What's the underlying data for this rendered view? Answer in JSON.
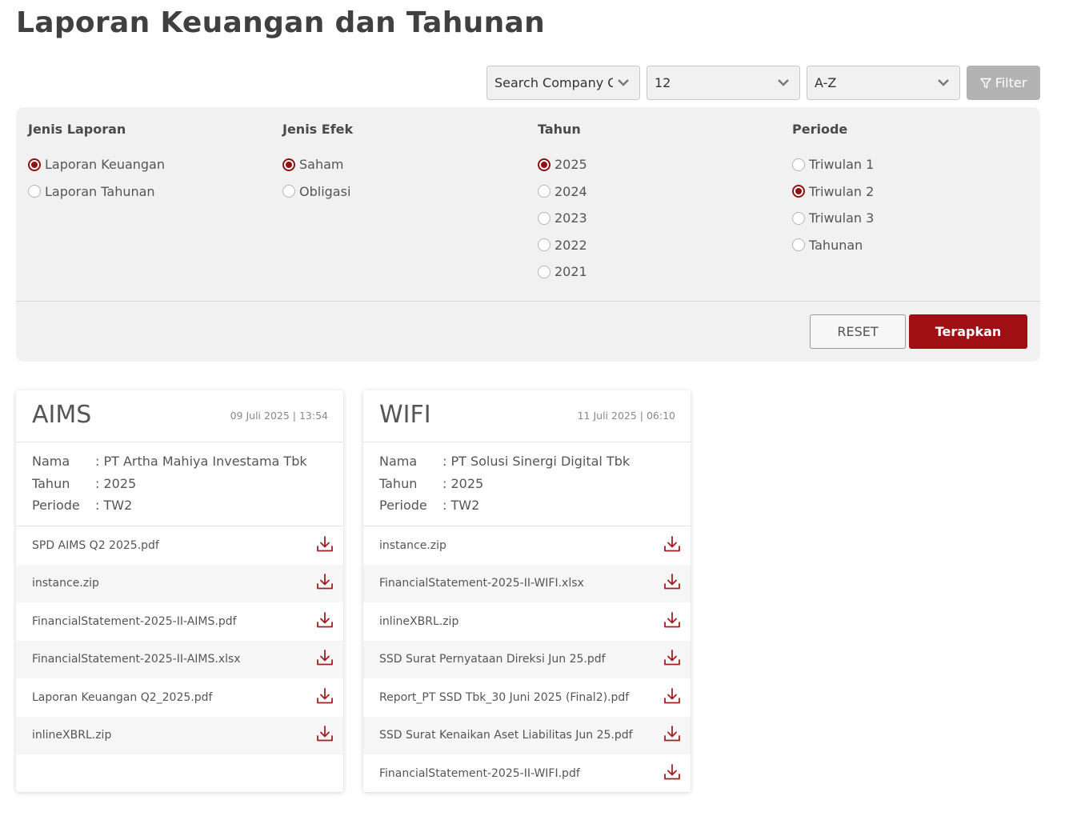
{
  "page": {
    "title": "Laporan Keuangan dan Tahunan"
  },
  "toolbar": {
    "search_value": "Search Company Code",
    "count_value": "12",
    "sort_value": "A-Z",
    "filter_label": "Filter"
  },
  "filters": {
    "jenis_laporan": {
      "title": "Jenis Laporan",
      "options": [
        {
          "label": "Laporan Keuangan",
          "selected": true
        },
        {
          "label": "Laporan Tahunan",
          "selected": false
        }
      ]
    },
    "jenis_efek": {
      "title": "Jenis Efek",
      "options": [
        {
          "label": "Saham",
          "selected": true
        },
        {
          "label": "Obligasi",
          "selected": false
        }
      ]
    },
    "tahun": {
      "title": "Tahun",
      "options": [
        {
          "label": "2025",
          "selected": true
        },
        {
          "label": "2024",
          "selected": false
        },
        {
          "label": "2023",
          "selected": false
        },
        {
          "label": "2022",
          "selected": false
        },
        {
          "label": "2021",
          "selected": false
        }
      ]
    },
    "periode": {
      "title": "Periode",
      "options": [
        {
          "label": "Triwulan 1",
          "selected": false
        },
        {
          "label": "Triwulan 2",
          "selected": true
        },
        {
          "label": "Triwulan 3",
          "selected": false
        },
        {
          "label": "Tahunan",
          "selected": false
        }
      ]
    },
    "reset_label": "RESET",
    "apply_label": "Terapkan"
  },
  "cards": [
    {
      "code": "AIMS",
      "date": "09 Juli 2025 | 13:54",
      "labels": {
        "nama": "Nama",
        "tahun": "Tahun",
        "periode": "Periode"
      },
      "nama": ": PT Artha Mahiya Investama Tbk",
      "tahun": ": 2025",
      "periode": ": TW2",
      "files": [
        "SPD AIMS Q2 2025.pdf",
        "instance.zip",
        "FinancialStatement-2025-II-AIMS.pdf",
        "FinancialStatement-2025-II-AIMS.xlsx",
        "Laporan Keuangan Q2_2025.pdf",
        "inlineXBRL.zip"
      ]
    },
    {
      "code": "WIFI",
      "date": "11 Juli 2025 | 06:10",
      "labels": {
        "nama": "Nama",
        "tahun": "Tahun",
        "periode": "Periode"
      },
      "nama": ": PT Solusi Sinergi Digital Tbk",
      "tahun": ": 2025",
      "periode": ": TW2",
      "files": [
        "instance.zip",
        "FinancialStatement-2025-II-WIFI.xlsx",
        "inlineXBRL.zip",
        "SSD Surat Pernyataan Direksi Jun 25.pdf",
        "Report_PT SSD Tbk_30 Juni 2025 (Final2).pdf",
        "SSD Surat Kenaikan Aset Liabilitas Jun 25.pdf",
        "FinancialStatement-2025-II-WIFI.pdf"
      ]
    }
  ],
  "colors": {
    "accent": "#a00f14",
    "panel": "#f1f1f1",
    "icon": "#a31d22"
  },
  "icons": {
    "download": "download-icon",
    "chevron": "chevron-down-icon",
    "filter": "funnel-icon"
  }
}
